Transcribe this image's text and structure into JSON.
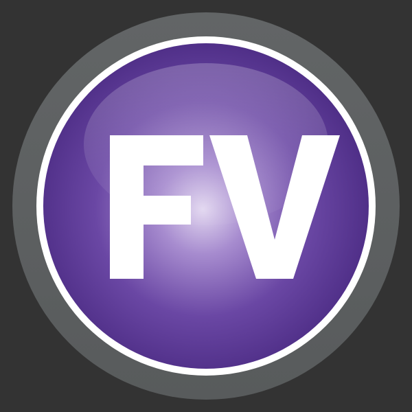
{
  "logo": {
    "text": "FV",
    "icon": "fv-badge-icon"
  },
  "colors": {
    "background": "#333333",
    "outer_ring": "#5E6162",
    "inner_ring": "#FFFFFF",
    "disc_dark": "#3D1F6E",
    "disc_mid": "#6E4AA8",
    "disc_light": "#D9CCEB",
    "letters": "#FFFFFF"
  }
}
